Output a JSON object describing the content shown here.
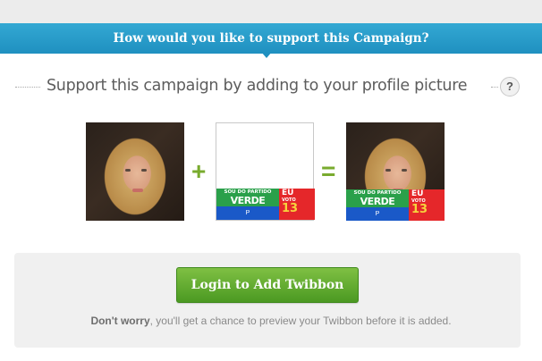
{
  "banner": {
    "title": "How would you like to support this Campaign?"
  },
  "section": {
    "subtitle": "Support this campaign by adding to your profile picture",
    "help_icon": "?"
  },
  "composition": {
    "plus": "+",
    "equals": "=",
    "twibbon": {
      "party_small": "SOU DO PARTIDO",
      "party_big": "VERDE",
      "eu": "EU",
      "voto": "VOTO",
      "number": "13",
      "logo_glyph": "P",
      "colors": {
        "green": "#2aa04a",
        "blue": "#1a59c8",
        "red": "#e5272a",
        "yellow": "#f6d33c"
      }
    }
  },
  "action": {
    "login_label": "Login to Add Twibbon",
    "note_bold": "Don't worry",
    "note_rest": ", you'll get a chance to preview your Twibbon before it is added."
  },
  "colors": {
    "banner": "#1f90c0",
    "button": "#5aa82c",
    "accent": "#79ab2e"
  }
}
